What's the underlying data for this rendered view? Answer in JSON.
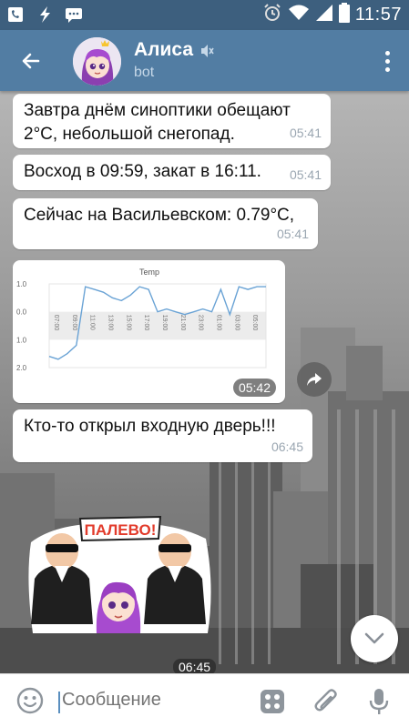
{
  "status_bar": {
    "time": "11:57",
    "left_icons": [
      "phone-voicemail-icon",
      "flash-icon",
      "message-icon"
    ],
    "right_icons": [
      "alarm-icon",
      "wifi-icon",
      "signal-icon",
      "battery-icon"
    ]
  },
  "header": {
    "name": "Алиса",
    "status": "bot",
    "muted": true
  },
  "messages": [
    {
      "text": "Завтра днём синоптики обещают\n2°C, небольшой снегопад.",
      "time": "05:41"
    },
    {
      "text": "Восход в 09:59, закат в 16:11.",
      "time": "05:41"
    },
    {
      "text": "Сейчас на Васильевском: 0.79°C,",
      "time": "05:41"
    },
    {
      "text": "Кто-то открыл входную дверь!!!",
      "time": "06:45"
    }
  ],
  "image_message": {
    "time": "05:42",
    "chart_data": {
      "type": "line",
      "title": "Temp",
      "ylim": [
        -2,
        1
      ],
      "y_ticks": [
        "1.0",
        "0.0",
        "1.0",
        "2.0"
      ],
      "x_ticks": [
        "07:00",
        "09:00",
        "11:00",
        "13:00",
        "15:00",
        "17:00",
        "19:00",
        "21:00",
        "23:00",
        "01:00",
        "03:00",
        "05:00"
      ],
      "series": [
        {
          "values": [
            -1.6,
            -1.7,
            -1.5,
            -1.2,
            0.9,
            0.8,
            0.7,
            0.5,
            0.4,
            0.6,
            0.9,
            0.8,
            0.0,
            0.1,
            0.0,
            -0.1,
            0.0,
            0.1,
            0.0,
            0.8,
            -0.1,
            0.9,
            0.8,
            0.9,
            0.9
          ]
        }
      ]
    }
  },
  "sticker": {
    "caption": "ПАЛЕВО!",
    "time": "06:45"
  },
  "input": {
    "placeholder": "Сообщение"
  },
  "colors": {
    "header": "#527da3",
    "status_bar": "#3d5f7e",
    "accent": "#5a8fbf"
  }
}
